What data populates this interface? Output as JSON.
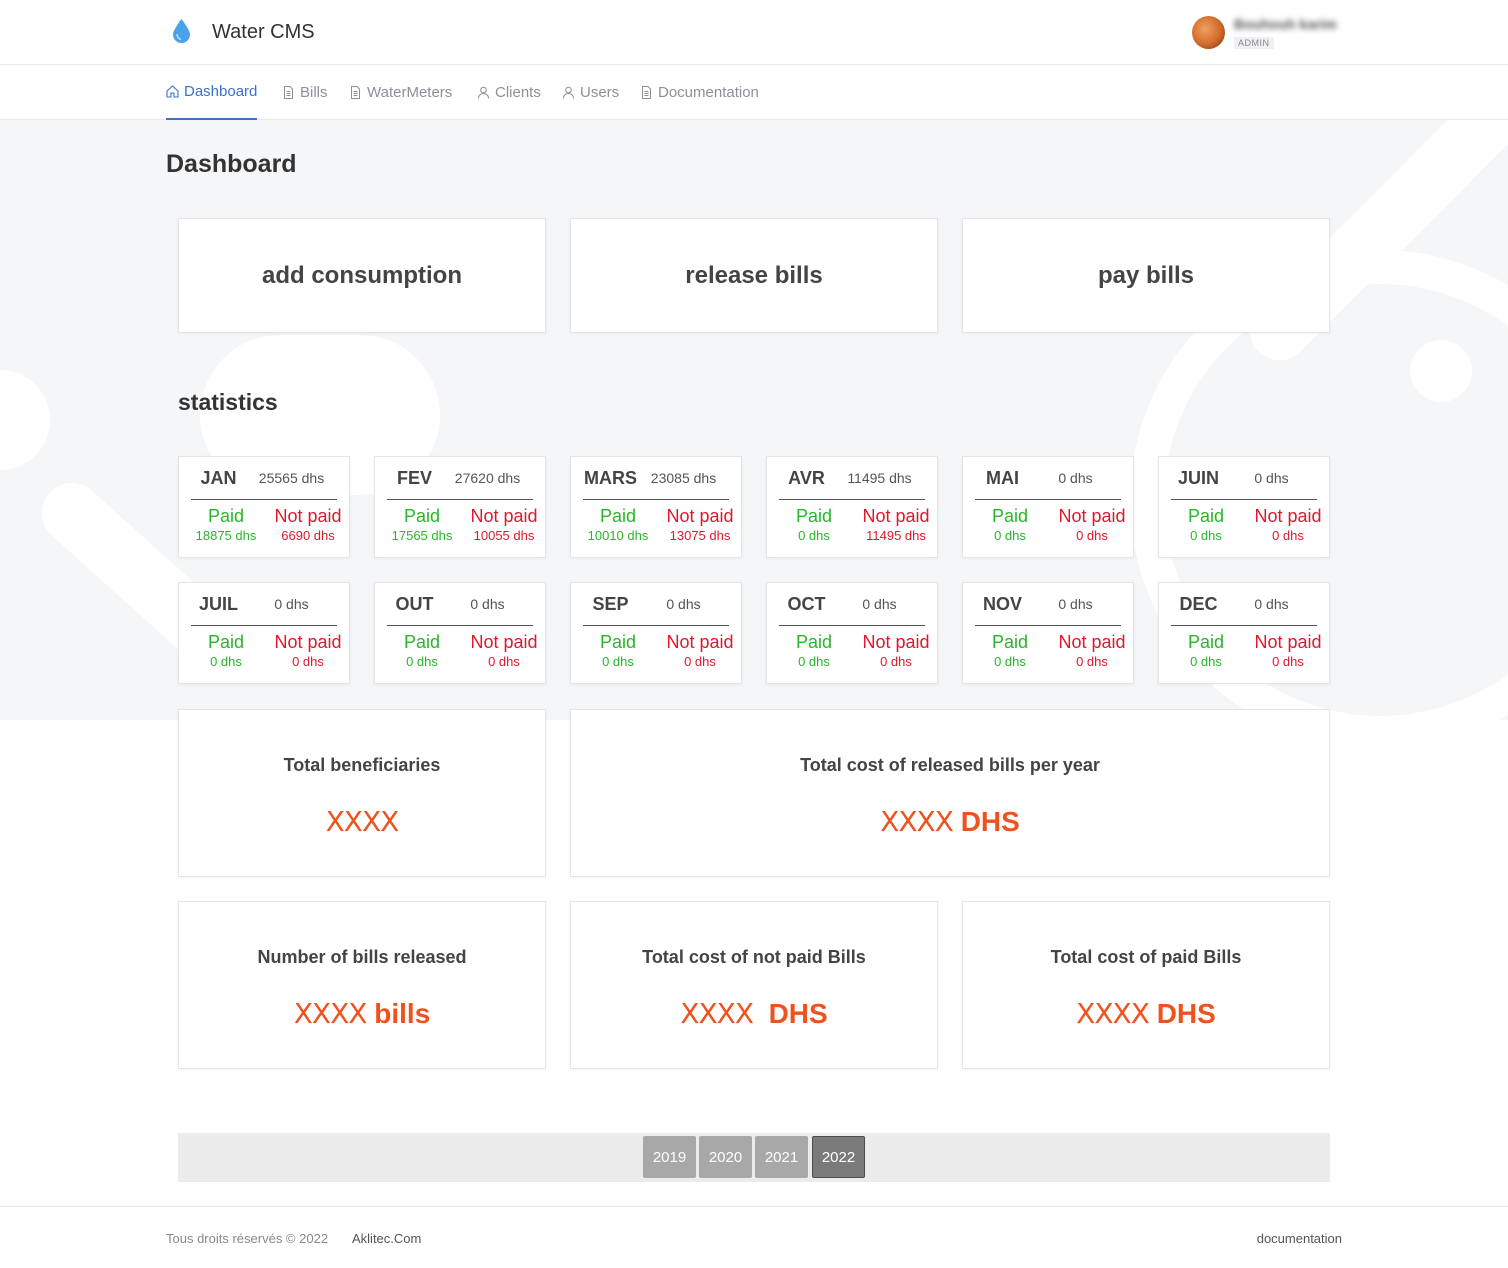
{
  "header": {
    "app_title": "Water CMS",
    "logo_icon": "water-drop-icon",
    "user_name": "Bouhouh karim",
    "user_role": "ADMIN"
  },
  "nav": [
    {
      "label": "Dashboard",
      "icon": "home-icon",
      "active": true
    },
    {
      "label": "Bills",
      "icon": "document-icon",
      "active": false
    },
    {
      "label": "WaterMeters",
      "icon": "document-icon",
      "active": false
    },
    {
      "label": "Clients",
      "icon": "user-icon",
      "active": false
    },
    {
      "label": "Users",
      "icon": "user-icon",
      "active": false
    },
    {
      "label": "Documentation",
      "icon": "document-icon",
      "active": false
    }
  ],
  "page_title": "Dashboard",
  "actions": [
    {
      "label": "add consumption"
    },
    {
      "label": "release bills"
    },
    {
      "label": "pay bills"
    }
  ],
  "stats_title": "statistics",
  "paid_label": "Paid",
  "not_paid_label": "Not paid",
  "months": [
    {
      "name": "JAN",
      "total": "25565 dhs",
      "paid": "18875 dhs",
      "not_paid": "6690 dhs"
    },
    {
      "name": "FEV",
      "total": "27620 dhs",
      "paid": "17565 dhs",
      "not_paid": "10055 dhs"
    },
    {
      "name": "MARS",
      "total": "23085 dhs",
      "paid": "10010 dhs",
      "not_paid": "13075 dhs"
    },
    {
      "name": "AVR",
      "total": "11495 dhs",
      "paid": "0 dhs",
      "not_paid": "11495 dhs"
    },
    {
      "name": "MAI",
      "total": "0 dhs",
      "paid": "0 dhs",
      "not_paid": "0 dhs"
    },
    {
      "name": "JUIN",
      "total": "0 dhs",
      "paid": "0 dhs",
      "not_paid": "0 dhs"
    },
    {
      "name": "JUIL",
      "total": "0 dhs",
      "paid": "0 dhs",
      "not_paid": "0 dhs"
    },
    {
      "name": "OUT",
      "total": "0 dhs",
      "paid": "0 dhs",
      "not_paid": "0 dhs"
    },
    {
      "name": "SEP",
      "total": "0 dhs",
      "paid": "0 dhs",
      "not_paid": "0 dhs"
    },
    {
      "name": "OCT",
      "total": "0 dhs",
      "paid": "0 dhs",
      "not_paid": "0 dhs"
    },
    {
      "name": "NOV",
      "total": "0 dhs",
      "paid": "0 dhs",
      "not_paid": "0 dhs"
    },
    {
      "name": "DEC",
      "total": "0 dhs",
      "paid": "0 dhs",
      "not_paid": "0 dhs"
    }
  ],
  "summary": {
    "beneficiaries": {
      "title": "Total beneficiaries",
      "value": "XXXX",
      "unit": ""
    },
    "released_cost": {
      "title": "Total cost of released bills per year",
      "value": "XXXX",
      "unit": "DHS"
    },
    "bills_count": {
      "title": "Number of bills released",
      "value": "XXXX",
      "unit": "bills"
    },
    "not_paid_cost": {
      "title": "Total cost of not paid Bills",
      "value": "XXXX",
      "unit": "DHS"
    },
    "paid_cost": {
      "title": "Total cost of paid Bills",
      "value": "XXXX",
      "unit": "DHS"
    }
  },
  "years": [
    {
      "label": "2019",
      "active": false
    },
    {
      "label": "2020",
      "active": false
    },
    {
      "label": "2021",
      "active": false
    },
    {
      "label": "2022",
      "active": true
    }
  ],
  "footer": {
    "copyright": "Tous droits réservés © 2022",
    "brand": "Aklitec.Com",
    "doc_link": "documentation"
  },
  "colors": {
    "accent": "#3a73c7",
    "paid": "#2ab52a",
    "not_paid": "#e0182c",
    "highlight": "#f0521e"
  }
}
